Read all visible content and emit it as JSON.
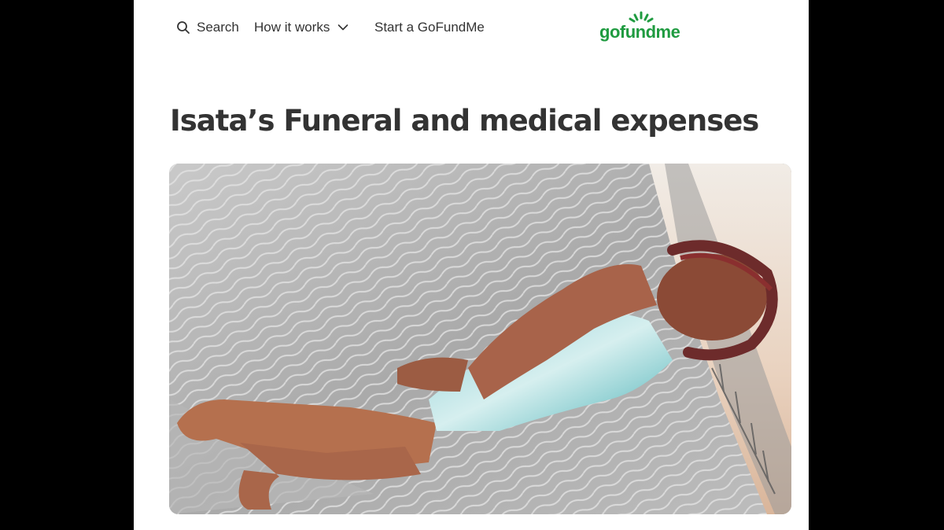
{
  "nav": {
    "search_label": "Search",
    "how_label": "How it works",
    "start_label": "Start a GoFundMe"
  },
  "logo": {
    "text": "gofundme"
  },
  "campaign": {
    "title": "Isata’s Funeral and medical expenses"
  },
  "colors": {
    "brand_green": "#1f9b40",
    "text_dark": "#333333",
    "page_background": "#ffffff",
    "letterbox": "#000000"
  },
  "icons": {
    "search": "search-icon",
    "dropdown": "chevron-down-icon"
  }
}
